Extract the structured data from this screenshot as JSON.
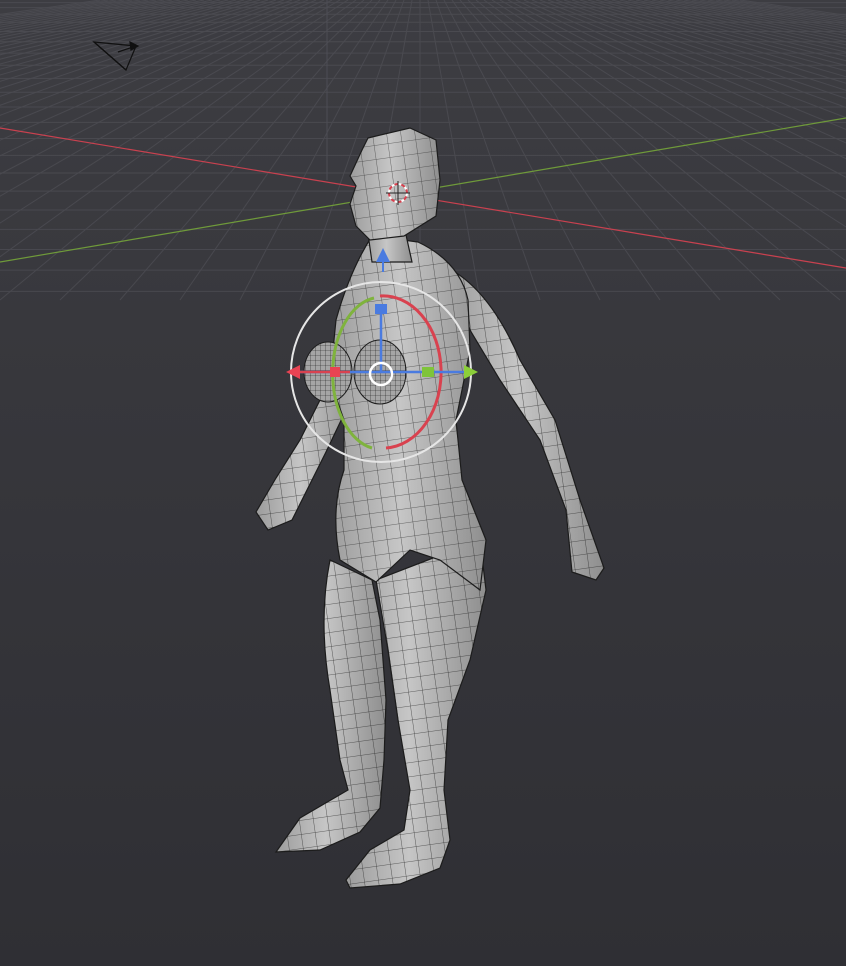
{
  "viewport": {
    "mode": "object-transform",
    "colors": {
      "background": "#3b3b3f",
      "grid": "#55555c",
      "x_axis": "#c9414f",
      "y_axis": "#6f9a3a",
      "z_axis": "#4a7be0",
      "mesh_fill": "#b8b8b8",
      "mesh_edge": "#1c1c1c",
      "gizmo_ring": "#e6e6e6"
    },
    "gizmo": {
      "handles": [
        "x-arrow-red",
        "y-arrow-green",
        "z-arrow-blue",
        "rotate-x-ring",
        "rotate-y-ring",
        "view-rotate-ring",
        "free-move-center"
      ]
    },
    "icons": [
      "camera-icon",
      "3d-cursor-icon"
    ]
  }
}
